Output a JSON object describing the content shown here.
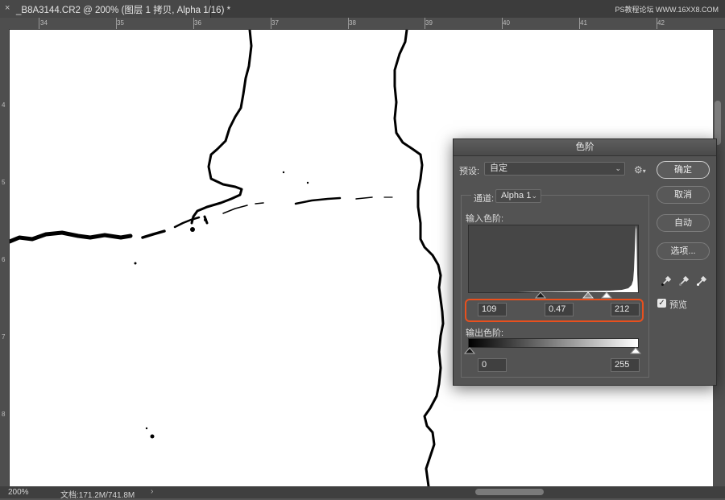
{
  "tab": {
    "close_glyph": "×",
    "title": "_B8A3144.CR2 @ 200% (图层 1 拷贝, Alpha 1/16) *"
  },
  "watermark": "PS教程论坛 WWW.16XX8.COM",
  "ruler": {
    "top_numbers": [
      "34",
      "35",
      "36",
      "37",
      "38",
      "39",
      "40",
      "41",
      "42"
    ],
    "left_numbers": [
      "4",
      "5",
      "6",
      "7",
      "8"
    ]
  },
  "status": {
    "zoom": "200%",
    "doc_info": "文档:171.2M/741.8M",
    "arrow": "›"
  },
  "levels_dialog": {
    "title": "色阶",
    "preset_label": "预设:",
    "preset_value": "自定",
    "channel_label": "通道:",
    "channel_value": "Alpha 1",
    "input_levels_label": "输入色阶:",
    "input_black": "109",
    "input_gamma": "0.47",
    "input_white": "212",
    "output_levels_label": "输出色阶:",
    "output_black": "0",
    "output_white": "255",
    "buttons": {
      "ok": "确定",
      "cancel": "取消",
      "auto": "自动",
      "options": "选项..."
    },
    "preview_label": "预览",
    "preview_checked": true
  },
  "colors": {
    "highlight": "#e8501e",
    "canvas": "#ffffff",
    "app_bg": "#535353"
  }
}
